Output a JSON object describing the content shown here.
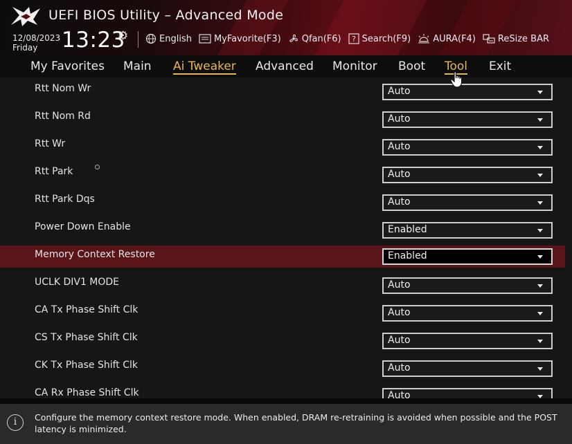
{
  "header": {
    "title": "UEFI BIOS Utility – Advanced Mode",
    "date": "12/08/2023",
    "day": "Friday",
    "time": "13:23",
    "tools": [
      {
        "name": "globe-icon",
        "label": "English"
      },
      {
        "name": "favorite-icon",
        "label": "MyFavorite(F3)"
      },
      {
        "name": "fan-icon",
        "label": "Qfan(F6)"
      },
      {
        "name": "search-icon",
        "label": "Search(F9)"
      },
      {
        "name": "aura-icon",
        "label": "AURA(F4)"
      },
      {
        "name": "resize-bar-icon",
        "label": "ReSize BAR"
      }
    ]
  },
  "nav": {
    "items": [
      "My Favorites",
      "Main",
      "Ai Tweaker",
      "Advanced",
      "Monitor",
      "Boot",
      "Tool",
      "Exit"
    ],
    "active": "Ai Tweaker",
    "accent_color": "#e8b84a"
  },
  "settings": [
    {
      "label": "Rtt Nom Wr",
      "value": "Auto"
    },
    {
      "label": "Rtt Nom Rd",
      "value": "Auto"
    },
    {
      "label": "Rtt Wr",
      "value": "Auto"
    },
    {
      "label": "Rtt Park",
      "value": "Auto"
    },
    {
      "label": "Rtt Park Dqs",
      "value": "Auto"
    },
    {
      "label": "Power Down Enable",
      "value": "Enabled"
    },
    {
      "label": "Memory Context Restore",
      "value": "Enabled",
      "selected": true
    },
    {
      "label": "UCLK DIV1 MODE",
      "value": "Auto"
    },
    {
      "label": "CA Tx Phase Shift Clk",
      "value": "Auto"
    },
    {
      "label": "CS Tx Phase Shift Clk",
      "value": "Auto"
    },
    {
      "label": "CK Tx Phase Shift Clk",
      "value": "Auto"
    },
    {
      "label": "CA Rx Phase Shift Clk",
      "value": "Auto"
    }
  ],
  "footer": {
    "help_text": "Configure the memory context restore mode. When enabled, DRAM re-retraining is avoided when possible and the POST latency is minimized."
  },
  "colors": {
    "selected_row": "#5a1518",
    "background": "#161616"
  }
}
